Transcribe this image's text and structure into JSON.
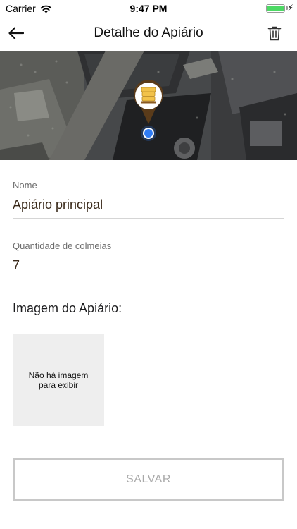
{
  "status_bar": {
    "carrier": "Carrier",
    "time": "9:47 PM",
    "battery_level": 1.0,
    "icons": [
      "wifi-icon",
      "battery-icon",
      "charging-bolt-icon"
    ]
  },
  "nav": {
    "title": "Detalhe do Apiário",
    "back_icon": "arrow-left-icon",
    "delete_icon": "trash-icon"
  },
  "map": {
    "type": "satellite",
    "markers": [
      "beehive-pin-icon",
      "current-location-dot"
    ]
  },
  "form": {
    "name": {
      "label": "Nome",
      "value": "Apiário principal"
    },
    "hives": {
      "label": "Quantidade de colmeias",
      "value": "7"
    }
  },
  "image_section": {
    "heading": "Imagem do Apiário:",
    "placeholder": "Não há imagem para exibir"
  },
  "save_button": {
    "label": "SALVAR",
    "enabled": false
  },
  "colors": {
    "accent_brown": "#5a3b1a",
    "hive_yellow": "#f2c24a",
    "location_blue": "#2f7cf6",
    "battery_green": "#4cd964"
  }
}
